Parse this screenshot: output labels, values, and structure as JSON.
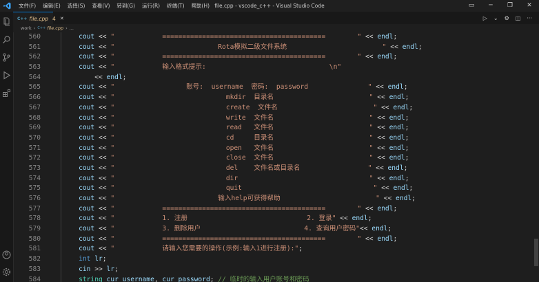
{
  "titlebar": {
    "menus": [
      "文件(F)",
      "编辑(E)",
      "选择(S)",
      "查看(V)",
      "转到(G)",
      "运行(R)",
      "终端(T)",
      "帮助(H)"
    ],
    "window_title": "file.cpp - vscode_c++ - Visual Studio Code"
  },
  "tab": {
    "filename": "file.cpp",
    "modified": "4",
    "icon_text": "C++"
  },
  "breadcrumb": {
    "folder": "work",
    "file": "file.cpp",
    "more": "..."
  },
  "editor": {
    "line_numbers": [
      "560",
      "561",
      "562",
      "563",
      "564",
      "565",
      "566",
      "567",
      "568",
      "569",
      "570",
      "571",
      "572",
      "573",
      "574",
      "575",
      "576",
      "577",
      "578",
      "579",
      "580",
      "581",
      "582",
      "583",
      "584"
    ],
    "lines": [
      "    cout << \"            =========================================        \" << endl;",
      "    cout << \"                          Rota模拟二级文件系统                        \" << endl;",
      "    cout << \"            =========================================        \" << endl;",
      "    cout << \"            输入格式提示:                               \\n\"",
      "        << endl;",
      "    cout << \"                  账号:  username  密码:  password               \" << endl;",
      "    cout << \"                            mkdir  目录名                        \" << endl;",
      "    cout << \"                            create  文件名                        \" << endl;",
      "    cout << \"                            write  文件名                        \" << endl;",
      "    cout << \"                            read   文件名                        \" << endl;",
      "    cout << \"                            cd     目录名                        \" << endl;",
      "    cout << \"                            open   文件名                        \" << endl;",
      "    cout << \"                            close  文件名                        \" << endl;",
      "    cout << \"                            del    文件名或目录名                 \" << endl;",
      "    cout << \"                            dir                                 \" << endl;",
      "    cout << \"                            quit                                 \" << endl;",
      "    cout << \"                          输入help可获得帮助                        \" << endl;",
      "    cout << \"            =========================================        \" << endl;",
      "    cout << \"            1. 注册                              2. 登录\" << endl;",
      "    cout << \"            3. 删除用户                          4. 查询用户密码\"<< endl;",
      "    cout << \"            =========================================        \" << endl;",
      "    cout << \"            请输入您需要的操作(示例:输入1进行注册):\";",
      "    int lr;",
      "    cin >> lr;",
      "    string cur_username, cur_password; // 临时的输入用户账号和密码"
    ]
  },
  "activity_icons": [
    "files-icon",
    "search-icon",
    "source-control-icon",
    "run-debug-icon",
    "extensions-icon"
  ],
  "colors": {
    "keyword": "#569cd6",
    "string": "#ce9178",
    "comment": "#6a9955",
    "variable": "#9cdcfe",
    "type": "#4ec9b0"
  }
}
